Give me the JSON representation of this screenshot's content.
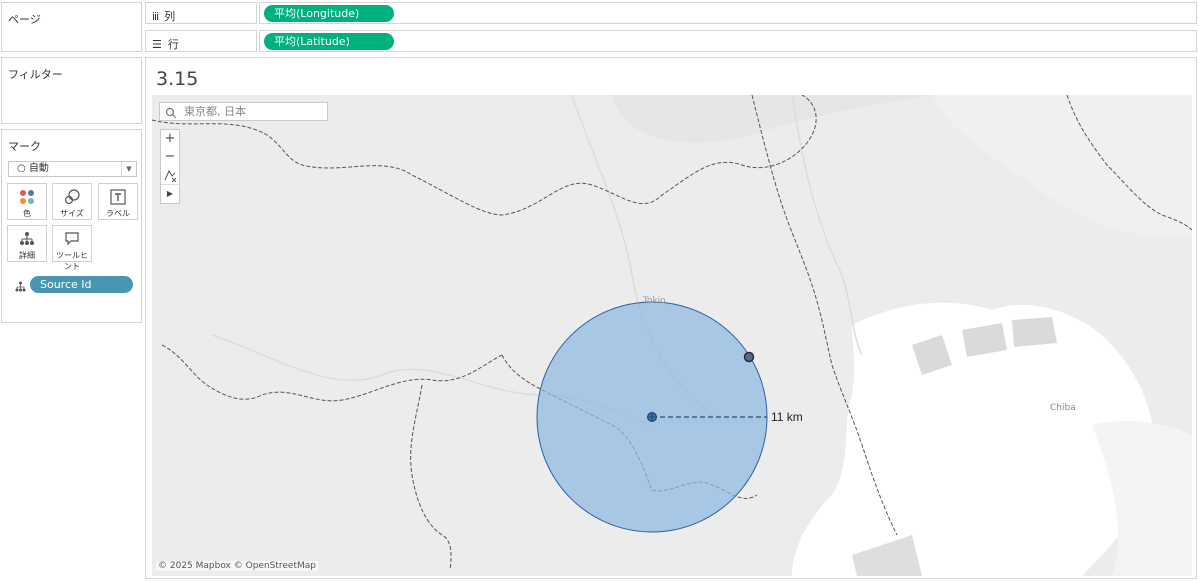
{
  "panels": {
    "pages": "ページ",
    "filters": "フィルター",
    "marks": "マーク"
  },
  "shelves": {
    "columns": {
      "label": "列",
      "pill": "平均(Longitude)"
    },
    "rows": {
      "label": "行",
      "pill": "平均(Latitude)"
    }
  },
  "marks": {
    "type": "自動",
    "buttons": {
      "color": "色",
      "size": "サイズ",
      "label": "ラベル",
      "detail": "詳細",
      "tooltip": "ツールヒント"
    },
    "detail_pill": "Source Id"
  },
  "sheet": {
    "title": "3.15"
  },
  "map": {
    "search_placeholder": "東京都, 日本",
    "labels": {
      "tokyo": "Tokio",
      "chiba": "Chiba"
    },
    "radius_label": "11 km",
    "attribution": "© 2025 Mapbox © OpenStreetMap",
    "zoom_in": "+",
    "zoom_out": "−"
  },
  "colors": {
    "pill_green": "#00b180",
    "pill_blue": "#4996b2",
    "circle_fill": "#9fc3e6",
    "circle_stroke": "#2a5f9e"
  }
}
